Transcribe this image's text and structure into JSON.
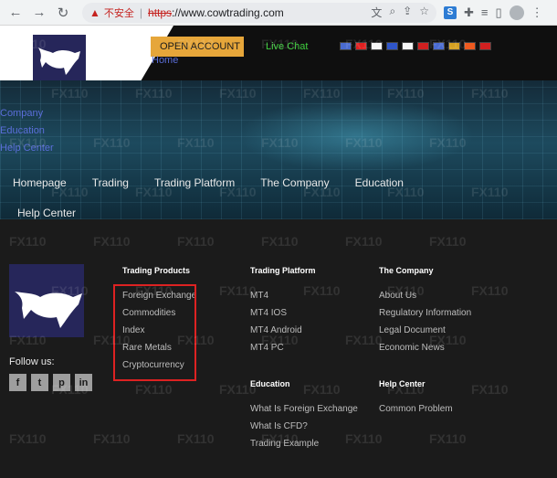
{
  "browser": {
    "warning_text": "不安全",
    "url_scheme": "https",
    "url_rest": "://www.cowtrading.com"
  },
  "header": {
    "open_account": "OPEN ACCOUNT",
    "home": "Home",
    "live_chat": "Live Chat",
    "flag_colors": [
      "#4a6bd1",
      "#e02020",
      "#f5f5f5",
      "#2f55c9",
      "#f5f5f5",
      "#d02020",
      "#4a6bd1",
      "#d6a020",
      "#ee5a1f",
      "#d02020"
    ]
  },
  "hero": {
    "side_links": [
      "Company",
      "Education",
      "Help Center"
    ],
    "nav": [
      "Homepage",
      "Trading",
      "Trading Platform",
      "The Company",
      "Education"
    ],
    "help_center": "Help Center"
  },
  "footer": {
    "follow_us": "Follow us:",
    "social_icons": [
      "facebook-icon",
      "twitter-icon",
      "pinterest-icon",
      "linkedin-icon"
    ],
    "trading_products": {
      "title": "Trading Products",
      "items": [
        "Foreign Exchange",
        "Commodities",
        "Index",
        "Rare Metals",
        "Cryptocurrency"
      ]
    },
    "trading_platform": {
      "title": "Trading Platform",
      "items": [
        "MT4",
        "MT4 IOS",
        "MT4 Android",
        "MT4 PC"
      ]
    },
    "the_company": {
      "title": "The Company",
      "items": [
        "About Us",
        "Regulatory Information",
        "Legal Document",
        "Economic News"
      ]
    },
    "education": {
      "title": "Education",
      "items": [
        "What Is Foreign Exchange",
        "What Is CFD?",
        "Trading Example"
      ]
    },
    "help_center": {
      "title": "Help Center",
      "items": [
        "Common Problem"
      ]
    }
  },
  "colors": {
    "accent_orange": "#e6a63a",
    "live_chat_green": "#3fcf3f",
    "link_blue": "#5a6ed8",
    "highlight_red": "#dd2222"
  }
}
